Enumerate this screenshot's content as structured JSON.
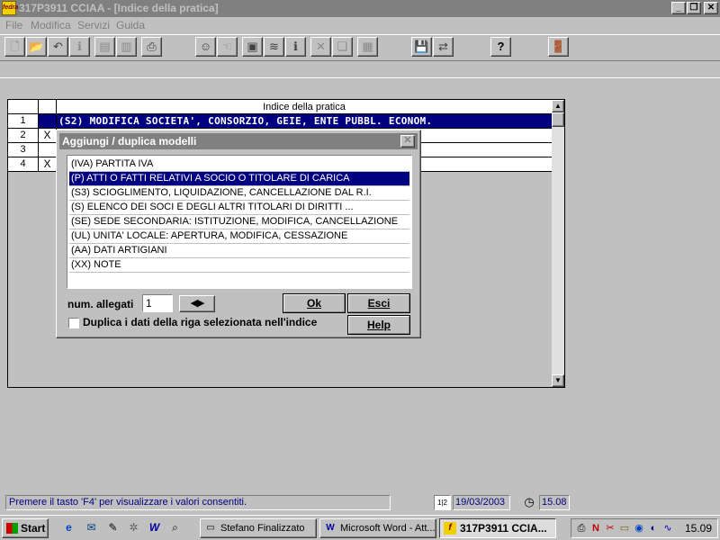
{
  "window": {
    "title": "317P3911 CCIAA - [Indice della pratica]",
    "app_icon_text": "fedra",
    "minimize": "_",
    "restore": "❐",
    "close": "✕"
  },
  "menu": {
    "items": [
      {
        "label": "File"
      },
      {
        "label": "Modifica"
      },
      {
        "label": "Servizi"
      },
      {
        "label": "Guida"
      }
    ]
  },
  "toolbar": {
    "buttons": [
      {
        "icon": "new-document-icon",
        "glyph": "🗋"
      },
      {
        "icon": "open-folder-icon",
        "glyph": "📂"
      },
      {
        "icon": "undo-icon",
        "glyph": "↶"
      },
      {
        "icon": "info-icon",
        "glyph": "ℹ"
      },
      {
        "icon": "page-icon",
        "glyph": "▤"
      },
      {
        "icon": "pages-icon",
        "glyph": "▥"
      },
      {
        "icon": "print-icon",
        "glyph": "⎙"
      },
      {
        "icon": "person-icon",
        "glyph": "☺"
      },
      {
        "icon": "hand-icon",
        "glyph": "☜"
      },
      {
        "icon": "save-disk-icon",
        "glyph": "▣"
      },
      {
        "icon": "layers-icon",
        "glyph": "≋"
      },
      {
        "icon": "info2-icon",
        "glyph": "ℹ"
      },
      {
        "icon": "delete-icon",
        "glyph": "✕"
      },
      {
        "icon": "copy-icon",
        "glyph": "❏"
      },
      {
        "icon": "table-icon",
        "glyph": "▦"
      },
      {
        "icon": "floppy-icon",
        "glyph": "💾"
      },
      {
        "icon": "transfer-icon",
        "glyph": "⇄"
      },
      {
        "icon": "help-icon",
        "glyph": "?"
      },
      {
        "icon": "exit-icon",
        "glyph": "🚪"
      }
    ]
  },
  "grid": {
    "header": "Indice della pratica",
    "rows": [
      {
        "num": "1",
        "mark": "",
        "text": "(S2) MODIFICA SOCIETA', CONSORZIO, GEIE, ENTE PUBBL. ECONOM."
      },
      {
        "num": "2",
        "mark": "X",
        "text": ""
      },
      {
        "num": "3",
        "mark": "",
        "text": ""
      },
      {
        "num": "4",
        "mark": "X",
        "text": ""
      }
    ],
    "scroll_up": "▲",
    "scroll_down": "▼"
  },
  "dialog": {
    "title": "Aggiungi / duplica modelli",
    "close": "✕",
    "list": [
      "(IVA) PARTITA IVA",
      "(P) ATTI O FATTI RELATIVI A SOCIO O TITOLARE DI CARICA",
      "(S3) SCIOGLIMENTO, LIQUIDAZIONE, CANCELLAZIONE DAL R.I.",
      "(S) ELENCO DEI SOCI E DEGLI ALTRI TITOLARI DI DIRITTI ...",
      "(SE) SEDE SECONDARIA: ISTITUZIONE, MODIFICA, CANCELLAZIONE",
      "(UL) UNITA' LOCALE: APERTURA, MODIFICA, CESSAZIONE",
      "(AA) DATI ARTIGIANI",
      "(XX) NOTE"
    ],
    "selected_index": 1,
    "allegati_label": "num. allegati",
    "allegati_value": "1",
    "spin_glyph": "◀▶",
    "ok_label": "Ok",
    "esci_label": "Esci",
    "help_label": "Help",
    "duplica_label": "Duplica i dati della riga selezionata nell'indice",
    "duplica_checked": false
  },
  "status": {
    "message": "Premere il tasto 'F4' per visualizzare i valori consentiti.",
    "calendar_glyph": "1|2",
    "date": "19/03/2003",
    "clock_glyph": "◷",
    "time": "15.08"
  },
  "taskbar": {
    "start_label": "Start",
    "quick_launch": [
      {
        "name": "ie-icon",
        "glyph": "e"
      },
      {
        "name": "outlook-icon",
        "glyph": "✉"
      },
      {
        "name": "notepad-icon",
        "glyph": "✎"
      },
      {
        "name": "gear-icon",
        "glyph": "✲"
      },
      {
        "name": "word-icon",
        "glyph": "W"
      },
      {
        "name": "find-icon",
        "glyph": "⌕"
      }
    ],
    "tasks": [
      {
        "label": "Stefano Finalizzato",
        "glyph": "▭",
        "active": false
      },
      {
        "label": "Microsoft Word - Att...",
        "glyph": "W",
        "active": false
      },
      {
        "label": "317P3911 CCIA...",
        "glyph": "f",
        "active": true
      }
    ],
    "tray_icons": [
      {
        "name": "printer-tray-icon",
        "glyph": "⎙"
      },
      {
        "name": "n-tray-icon",
        "glyph": "N"
      },
      {
        "name": "tool-tray-icon",
        "glyph": "✂"
      },
      {
        "name": "monitor-tray-icon",
        "glyph": "▭"
      },
      {
        "name": "globe-tray-icon",
        "glyph": "◉"
      },
      {
        "name": "moon-tray-icon",
        "glyph": "◐"
      },
      {
        "name": "wave-tray-icon",
        "glyph": "∿"
      }
    ],
    "clock": "15.09"
  }
}
